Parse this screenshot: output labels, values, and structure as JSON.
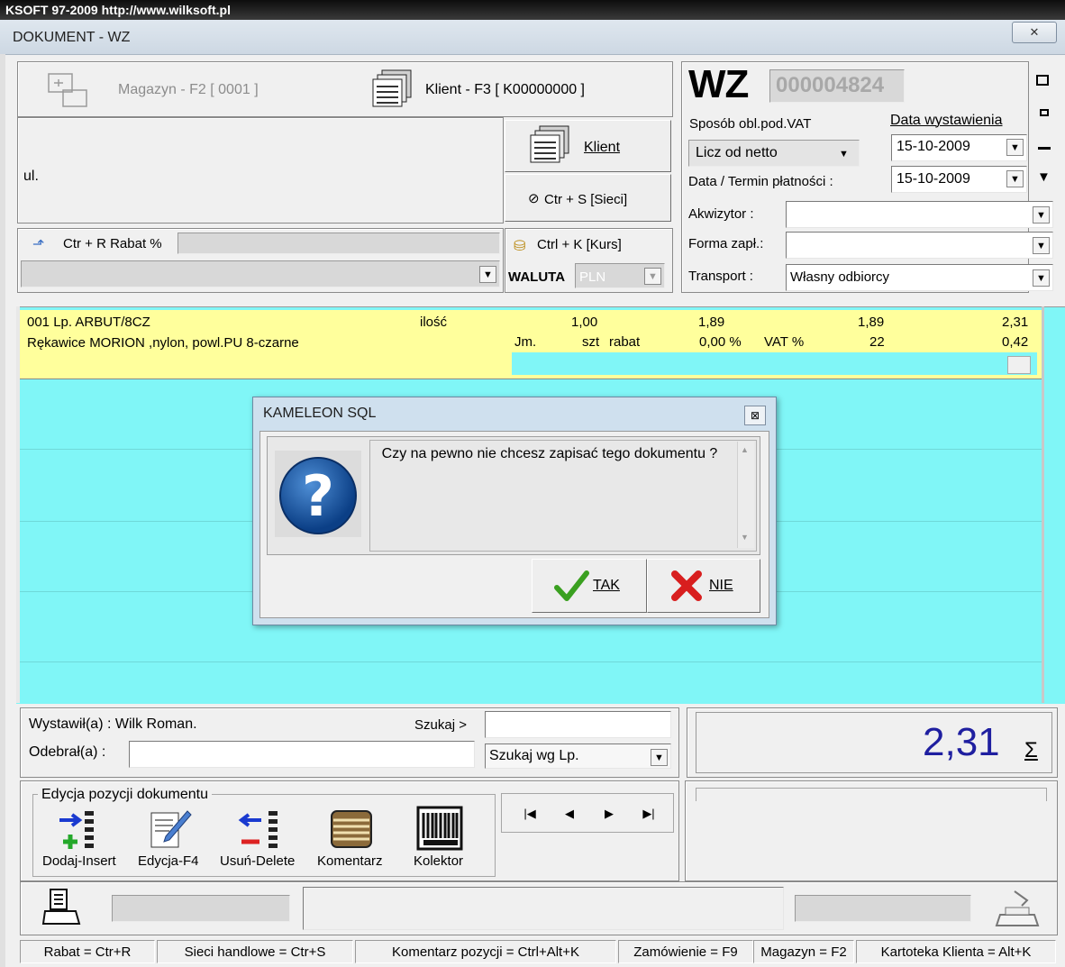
{
  "title_bar": {
    "top_strip": "KSOFT 97-2009  http://www.wilksoft.pl",
    "window_title": "DOKUMENT - WZ",
    "close_glyph": "✕"
  },
  "header": {
    "magazyn_label": "Magazyn - F2 [ 0001 ]",
    "klient_f3_label": "Klient - F3 [ K00000000 ]",
    "klient_button": "Klient",
    "sieci_button": "Ctr + S [Sieci]",
    "address_text": "ul.",
    "rabat_label": "Ctr + R Rabat %",
    "kurs_label": "Ctrl + K [Kurs]",
    "waluta_label": "WALUTA",
    "waluta_value": "PLN"
  },
  "doc": {
    "type": "WZ",
    "number": "000004824",
    "vat_method_label": "Sposób obl.pod.VAT",
    "vat_method_value": "Licz od netto",
    "issue_date_label": "Data wystawienia",
    "issue_date_value": "15-10-2009",
    "payment_date_label": "Data / Termin  płatności :",
    "payment_date_value": "15-10-2009",
    "akwizytor_label": "Akwizytor    :",
    "forma_label": "Forma zapł.:",
    "transport_label": "Transport   :",
    "transport_value": "Własny odbiorcy"
  },
  "item": {
    "lp_label": "001  Lp.  ARBUT/8CZ",
    "ilosc_label": "ilość",
    "qty": "1,00",
    "price1": "1,89",
    "price2": "1,89",
    "gross": "2,31",
    "name": "Rękawice MORION ,nylon, powl.PU 8-czarne",
    "jm_label": "Jm.",
    "jm_value": "szt",
    "rabat_label": "rabat",
    "rabat_value": "0,00 %",
    "vat_label": "VAT %",
    "vat_value": "22",
    "vat_amount": "0,42"
  },
  "dialog": {
    "title": "KAMELEON SQL",
    "message": "Czy na pewno nie chcesz zapisać tego dokumentu ?",
    "yes_label": "TAK",
    "no_label": "NIE",
    "close_glyph": "⊠"
  },
  "footer": {
    "wystawil": "Wystawił(a) : Wilk Roman.",
    "szukaj_label": "Szukaj  >",
    "odebral_label": "Odebrał(a)  :",
    "szukaj_wg": "Szukaj wg Lp.",
    "total": "2,31",
    "sigma": "Σ"
  },
  "edit_group": {
    "legend": "Edycja pozycji dokumentu",
    "buttons": [
      "Dodaj-Insert",
      "Edycja-F4",
      "Usuń-Delete",
      "Komentarz",
      "Kolektor"
    ]
  },
  "nav": [
    "|◀",
    "◀",
    "▶",
    "▶|"
  ],
  "status_bar": [
    "Rabat = Ctr+R",
    "Sieci handlowe = Ctr+S",
    "Komentarz pozycji = Ctrl+Alt+K",
    "Zamówienie = F9",
    "Magazyn = F2",
    "Kartoteka Klienta = Alt+K"
  ],
  "colors": {
    "grid_bg": "#80f6f7",
    "row_yellow": "#ffff9c",
    "total_blue": "#1f1fa0"
  }
}
